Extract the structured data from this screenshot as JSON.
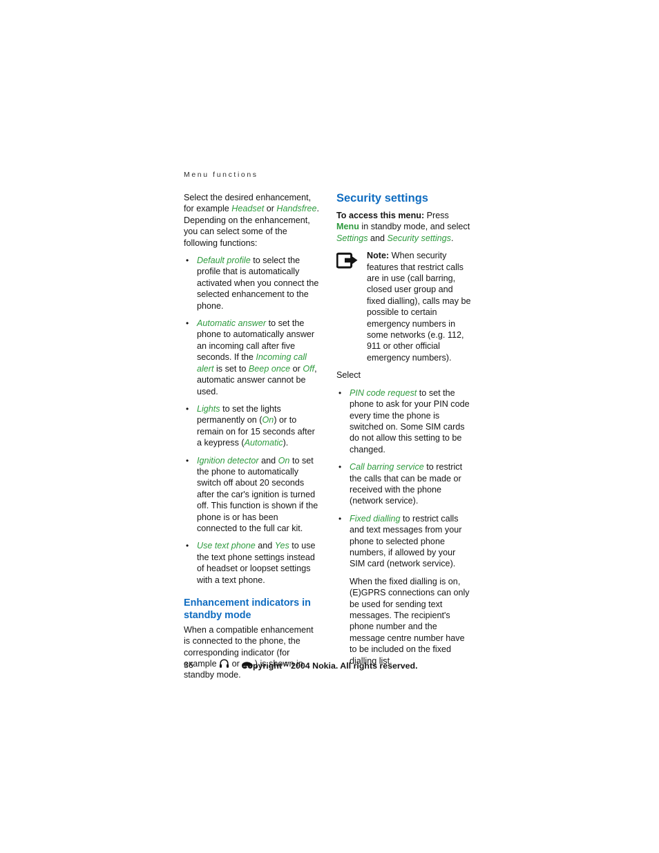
{
  "page": {
    "running_header": "Menu functions",
    "folio": "36",
    "copyright_pre": "Copyright ",
    "copyright_symbol": "©",
    "copyright_post": " 2004 Nokia. All rights reserved."
  },
  "colors": {
    "accent_green": "#2e9a3e",
    "heading_blue": "#0f6cc0",
    "body_text": "#141414"
  },
  "left_column": {
    "intro": {
      "t1": "Select the desired enhancement, for example ",
      "em1": "Headset",
      "t2": " or ",
      "em2": "Handsfree",
      "t3": ". Depending on the enhancement, you can select some of the following functions:"
    },
    "bullets": [
      {
        "em1": "Default profile",
        "t1": " to select the profile that is automatically activated when you connect the selected enhancement to the phone."
      },
      {
        "em1": "Automatic answer",
        "t1": " to set the phone to automatically answer an incoming call after five seconds. If the ",
        "em2": "Incoming call alert",
        "t2": " is set to ",
        "em3": "Beep once",
        "t3": " or ",
        "em4": "Off",
        "t4": ", automatic answer cannot be used."
      },
      {
        "em1": "Lights",
        "t1": " to set the lights permanently on (",
        "em2": "On",
        "t2": ") or to remain on for 15 seconds after a keypress (",
        "em3": "Automatic",
        "t3": ")."
      },
      {
        "em1": "Ignition detector",
        "t1": " and ",
        "em2": "On",
        "t2": " to set the phone to automatically switch off about 20 seconds after the car's ignition is turned off. This function is shown if the phone is or has been connected to the full car kit."
      },
      {
        "em1": "Use text phone",
        "t1": " and ",
        "em2": "Yes",
        "t2": " to use the text phone settings instead of headset or loopset settings with a text phone."
      }
    ],
    "subheading": "Enhancement indicators in standby mode",
    "indicators_para": {
      "t1": "When a compatible enhancement is connected to the phone, the corresponding indicator (for example ",
      "icon1": "headset-icon",
      "t2": " or ",
      "icon2": "car-icon",
      "t3": " ) is shown in standby mode."
    }
  },
  "right_column": {
    "heading": "Security settings",
    "access": {
      "bold": "To access this menu:",
      "t1": " Press ",
      "em_bold": "Menu",
      "t2": " in standby mode, and select ",
      "em1": "Settings",
      "t3": " and ",
      "em2": "Security settings",
      "t4": "."
    },
    "note": {
      "icon": "note-arrow-icon",
      "label": "Note:",
      "text": " When security features that restrict calls are in use (call barring, closed user group and fixed dialling), calls may be possible to certain emergency numbers in some networks (e.g. 112, 911 or other official emergency numbers)."
    },
    "select_label": "Select",
    "bullets": [
      {
        "em1": "PIN code request",
        "t1": " to set the phone to ask for your PIN code every time the phone is switched on. Some SIM cards do not allow this setting to be changed."
      },
      {
        "em1": "Call barring service",
        "t1": " to restrict the calls that can be made or received with the phone (network service)."
      },
      {
        "em1": "Fixed dialling",
        "t1": " to restrict calls and text messages from your phone to selected phone numbers, if allowed by your SIM card (network service)."
      }
    ],
    "closing_para": "When the fixed dialling is on, (E)GPRS connections can only be used for sending text messages. The recipient's phone number and the message centre number have to be included on the fixed dialling list."
  }
}
